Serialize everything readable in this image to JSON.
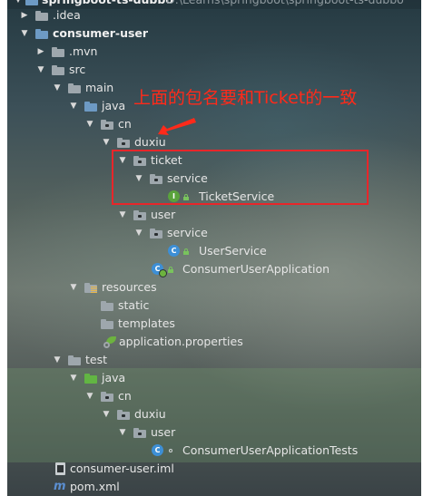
{
  "tree": {
    "root_label": "springboot-ts-dubbo",
    "root_path": "D:\\Learns\\springboot\\springboot-ts-dubbo",
    "items": {
      "idea": ".idea",
      "consumer_user": "consumer-user",
      "mvn": ".mvn",
      "src": "src",
      "main": "main",
      "java": "java",
      "cn": "cn",
      "duxiu": "duxiu",
      "ticket": "ticket",
      "ticket_service_pkg": "service",
      "ticket_service": "TicketService",
      "user": "user",
      "user_service_pkg": "service",
      "user_service": "UserService",
      "consumer_app": "ConsumerUserApplication",
      "resources": "resources",
      "static": "static",
      "templates": "templates",
      "application_properties": "application.properties",
      "test": "test",
      "test_java": "java",
      "test_cn": "cn",
      "test_duxiu": "duxiu",
      "test_user": "user",
      "consumer_tests": "ConsumerUserApplicationTests",
      "consumer_iml": "consumer-user.iml",
      "pom": "pom.xml"
    },
    "icons": {
      "interface_letter": "I",
      "class_letter": "C",
      "maven_letter": "m"
    }
  },
  "annotation": {
    "text": "上面的包名要和Ticket的一致",
    "color": "#ff2a1a",
    "box_color": "#e8262a"
  }
}
